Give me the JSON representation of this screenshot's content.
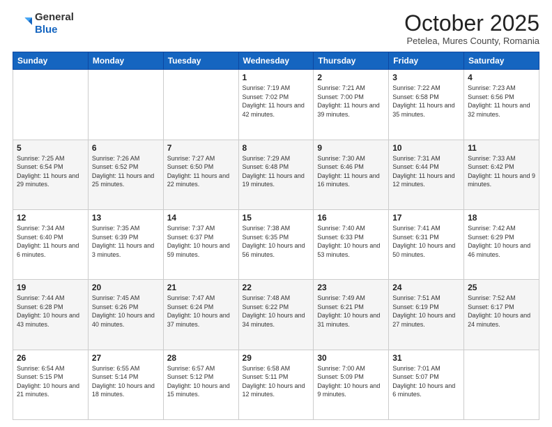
{
  "header": {
    "logo": {
      "general": "General",
      "blue": "Blue"
    },
    "title": "October 2025",
    "location": "Petelea, Mures County, Romania"
  },
  "weekdays": [
    "Sunday",
    "Monday",
    "Tuesday",
    "Wednesday",
    "Thursday",
    "Friday",
    "Saturday"
  ],
  "weeks": [
    [
      {
        "day": "",
        "sunrise": "",
        "sunset": "",
        "daylight": ""
      },
      {
        "day": "",
        "sunrise": "",
        "sunset": "",
        "daylight": ""
      },
      {
        "day": "",
        "sunrise": "",
        "sunset": "",
        "daylight": ""
      },
      {
        "day": "1",
        "sunrise": "Sunrise: 7:19 AM",
        "sunset": "Sunset: 7:02 PM",
        "daylight": "Daylight: 11 hours and 42 minutes."
      },
      {
        "day": "2",
        "sunrise": "Sunrise: 7:21 AM",
        "sunset": "Sunset: 7:00 PM",
        "daylight": "Daylight: 11 hours and 39 minutes."
      },
      {
        "day": "3",
        "sunrise": "Sunrise: 7:22 AM",
        "sunset": "Sunset: 6:58 PM",
        "daylight": "Daylight: 11 hours and 35 minutes."
      },
      {
        "day": "4",
        "sunrise": "Sunrise: 7:23 AM",
        "sunset": "Sunset: 6:56 PM",
        "daylight": "Daylight: 11 hours and 32 minutes."
      }
    ],
    [
      {
        "day": "5",
        "sunrise": "Sunrise: 7:25 AM",
        "sunset": "Sunset: 6:54 PM",
        "daylight": "Daylight: 11 hours and 29 minutes."
      },
      {
        "day": "6",
        "sunrise": "Sunrise: 7:26 AM",
        "sunset": "Sunset: 6:52 PM",
        "daylight": "Daylight: 11 hours and 25 minutes."
      },
      {
        "day": "7",
        "sunrise": "Sunrise: 7:27 AM",
        "sunset": "Sunset: 6:50 PM",
        "daylight": "Daylight: 11 hours and 22 minutes."
      },
      {
        "day": "8",
        "sunrise": "Sunrise: 7:29 AM",
        "sunset": "Sunset: 6:48 PM",
        "daylight": "Daylight: 11 hours and 19 minutes."
      },
      {
        "day": "9",
        "sunrise": "Sunrise: 7:30 AM",
        "sunset": "Sunset: 6:46 PM",
        "daylight": "Daylight: 11 hours and 16 minutes."
      },
      {
        "day": "10",
        "sunrise": "Sunrise: 7:31 AM",
        "sunset": "Sunset: 6:44 PM",
        "daylight": "Daylight: 11 hours and 12 minutes."
      },
      {
        "day": "11",
        "sunrise": "Sunrise: 7:33 AM",
        "sunset": "Sunset: 6:42 PM",
        "daylight": "Daylight: 11 hours and 9 minutes."
      }
    ],
    [
      {
        "day": "12",
        "sunrise": "Sunrise: 7:34 AM",
        "sunset": "Sunset: 6:40 PM",
        "daylight": "Daylight: 11 hours and 6 minutes."
      },
      {
        "day": "13",
        "sunrise": "Sunrise: 7:35 AM",
        "sunset": "Sunset: 6:39 PM",
        "daylight": "Daylight: 11 hours and 3 minutes."
      },
      {
        "day": "14",
        "sunrise": "Sunrise: 7:37 AM",
        "sunset": "Sunset: 6:37 PM",
        "daylight": "Daylight: 10 hours and 59 minutes."
      },
      {
        "day": "15",
        "sunrise": "Sunrise: 7:38 AM",
        "sunset": "Sunset: 6:35 PM",
        "daylight": "Daylight: 10 hours and 56 minutes."
      },
      {
        "day": "16",
        "sunrise": "Sunrise: 7:40 AM",
        "sunset": "Sunset: 6:33 PM",
        "daylight": "Daylight: 10 hours and 53 minutes."
      },
      {
        "day": "17",
        "sunrise": "Sunrise: 7:41 AM",
        "sunset": "Sunset: 6:31 PM",
        "daylight": "Daylight: 10 hours and 50 minutes."
      },
      {
        "day": "18",
        "sunrise": "Sunrise: 7:42 AM",
        "sunset": "Sunset: 6:29 PM",
        "daylight": "Daylight: 10 hours and 46 minutes."
      }
    ],
    [
      {
        "day": "19",
        "sunrise": "Sunrise: 7:44 AM",
        "sunset": "Sunset: 6:28 PM",
        "daylight": "Daylight: 10 hours and 43 minutes."
      },
      {
        "day": "20",
        "sunrise": "Sunrise: 7:45 AM",
        "sunset": "Sunset: 6:26 PM",
        "daylight": "Daylight: 10 hours and 40 minutes."
      },
      {
        "day": "21",
        "sunrise": "Sunrise: 7:47 AM",
        "sunset": "Sunset: 6:24 PM",
        "daylight": "Daylight: 10 hours and 37 minutes."
      },
      {
        "day": "22",
        "sunrise": "Sunrise: 7:48 AM",
        "sunset": "Sunset: 6:22 PM",
        "daylight": "Daylight: 10 hours and 34 minutes."
      },
      {
        "day": "23",
        "sunrise": "Sunrise: 7:49 AM",
        "sunset": "Sunset: 6:21 PM",
        "daylight": "Daylight: 10 hours and 31 minutes."
      },
      {
        "day": "24",
        "sunrise": "Sunrise: 7:51 AM",
        "sunset": "Sunset: 6:19 PM",
        "daylight": "Daylight: 10 hours and 27 minutes."
      },
      {
        "day": "25",
        "sunrise": "Sunrise: 7:52 AM",
        "sunset": "Sunset: 6:17 PM",
        "daylight": "Daylight: 10 hours and 24 minutes."
      }
    ],
    [
      {
        "day": "26",
        "sunrise": "Sunrise: 6:54 AM",
        "sunset": "Sunset: 5:15 PM",
        "daylight": "Daylight: 10 hours and 21 minutes."
      },
      {
        "day": "27",
        "sunrise": "Sunrise: 6:55 AM",
        "sunset": "Sunset: 5:14 PM",
        "daylight": "Daylight: 10 hours and 18 minutes."
      },
      {
        "day": "28",
        "sunrise": "Sunrise: 6:57 AM",
        "sunset": "Sunset: 5:12 PM",
        "daylight": "Daylight: 10 hours and 15 minutes."
      },
      {
        "day": "29",
        "sunrise": "Sunrise: 6:58 AM",
        "sunset": "Sunset: 5:11 PM",
        "daylight": "Daylight: 10 hours and 12 minutes."
      },
      {
        "day": "30",
        "sunrise": "Sunrise: 7:00 AM",
        "sunset": "Sunset: 5:09 PM",
        "daylight": "Daylight: 10 hours and 9 minutes."
      },
      {
        "day": "31",
        "sunrise": "Sunrise: 7:01 AM",
        "sunset": "Sunset: 5:07 PM",
        "daylight": "Daylight: 10 hours and 6 minutes."
      },
      {
        "day": "",
        "sunrise": "",
        "sunset": "",
        "daylight": ""
      }
    ]
  ]
}
